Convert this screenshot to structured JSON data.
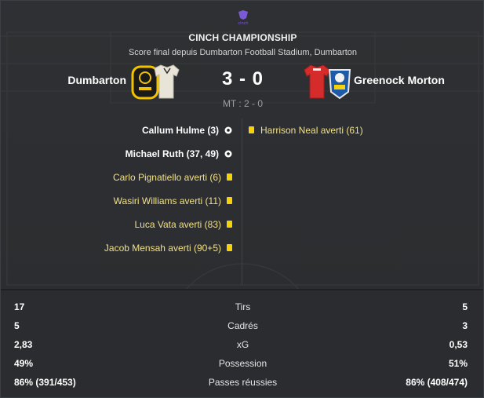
{
  "competition": "CINCH CHAMPIONSHIP",
  "venue": "Score final depuis Dumbarton Football Stadium, Dumbarton",
  "home_team": "Dumbarton",
  "away_team": "Greenock Morton",
  "score": "3 - 0",
  "halftime": "MT : 2 - 0",
  "colors": {
    "card_yellow": "#f5d20a",
    "card_text": "#f0e08a",
    "home_kit": "#1a1a1a",
    "home_kit_accent": "#f2c200",
    "away_kit": "#d62b2b"
  },
  "home_events": [
    {
      "text": "Callum Hulme (3)",
      "type": "goal",
      "icon": "football-icon"
    },
    {
      "text": "Michael Ruth (37, 49)",
      "type": "goal",
      "icon": "football-icon"
    },
    {
      "text": "Carlo Pignatiello averti (6)",
      "type": "yellow",
      "icon": "yellow-card-icon"
    },
    {
      "text": "Wasiri Williams averti (11)",
      "type": "yellow",
      "icon": "yellow-card-icon"
    },
    {
      "text": "Luca Vata averti (83)",
      "type": "yellow",
      "icon": "yellow-card-icon"
    },
    {
      "text": "Jacob Mensah averti (90+5)",
      "type": "yellow",
      "icon": "yellow-card-icon"
    }
  ],
  "away_events": [
    {
      "text": "Harrison Neal averti (61)",
      "type": "yellow",
      "icon": "yellow-card-icon"
    }
  ],
  "stats": [
    {
      "label": "Tirs",
      "home": "17",
      "away": "5"
    },
    {
      "label": "Cadrés",
      "home": "5",
      "away": "3"
    },
    {
      "label": "xG",
      "home": "2,83",
      "away": "0,53"
    },
    {
      "label": "Possession",
      "home": "49%",
      "away": "51%"
    },
    {
      "label": "Passes réussies",
      "home": "86% (391/453)",
      "away": "86% (408/474)"
    }
  ]
}
